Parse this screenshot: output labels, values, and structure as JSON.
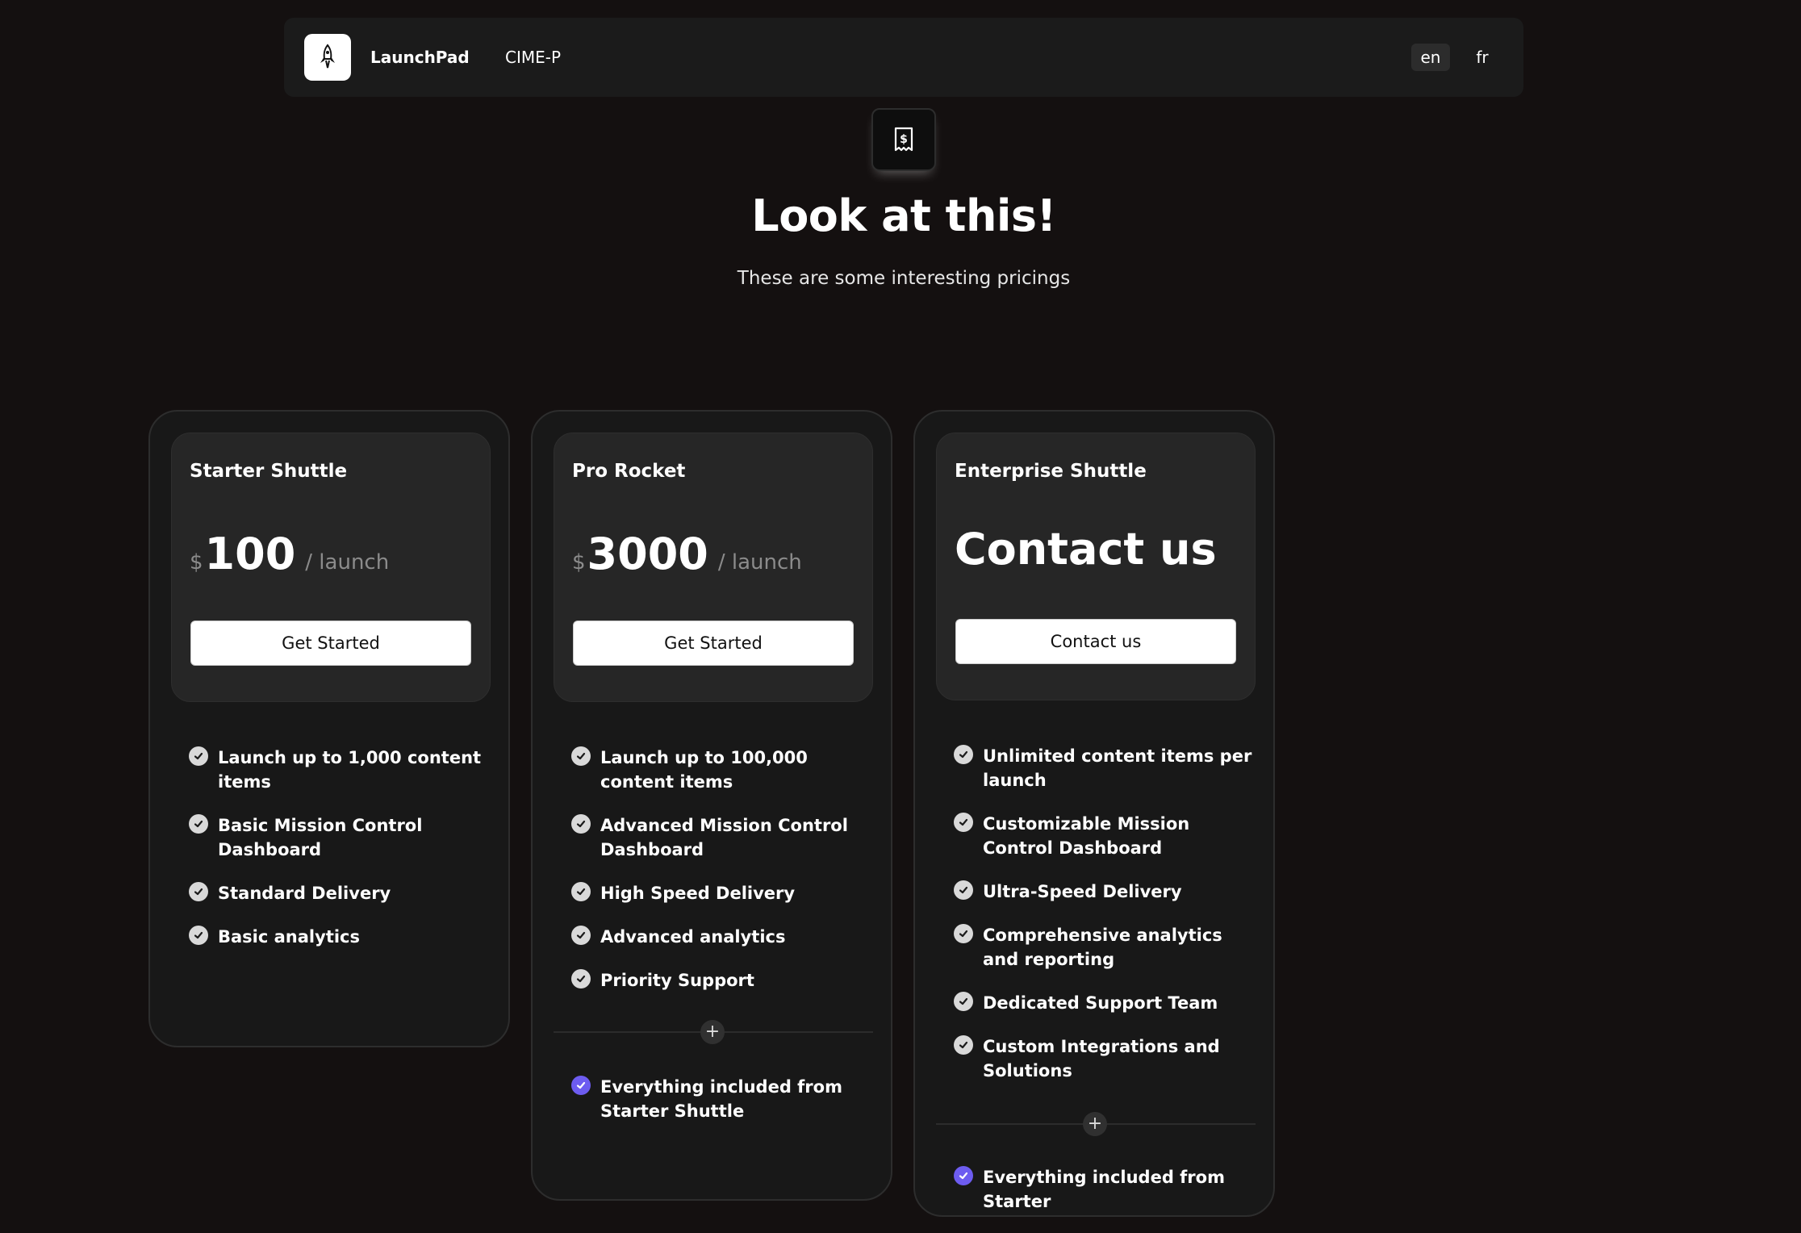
{
  "nav": {
    "brand": "LaunchPad",
    "link": "CIME-P",
    "languages": [
      "en",
      "fr"
    ],
    "active_language": "en",
    "logo_icon": "rocket-icon"
  },
  "hero": {
    "icon": "receipt-dollar-icon",
    "title": "Look at this!",
    "subtitle": "These are some interesting pricings"
  },
  "plans": [
    {
      "name": "Starter Shuttle",
      "currency": "$",
      "price": "100",
      "period": "/ launch",
      "cta": "Get Started",
      "features": [
        "Launch up to 1,000 content items",
        "Basic Mission Control Dashboard",
        "Standard Delivery",
        "Basic analytics"
      ]
    },
    {
      "name": "Pro Rocket",
      "currency": "$",
      "price": "3000",
      "period": "/ launch",
      "cta": "Get Started",
      "features": [
        "Launch up to 100,000 content items",
        "Advanced Mission Control Dashboard",
        "High Speed Delivery",
        "Advanced analytics",
        "Priority Support"
      ],
      "included": "Everything included from Starter Shuttle"
    },
    {
      "name": "Enterprise Shuttle",
      "price_text": "Contact us",
      "cta": "Contact us",
      "features": [
        "Unlimited content items per launch",
        "Customizable Mission Control Dashboard",
        "Ultra-Speed Delivery",
        "Comprehensive analytics and reporting",
        "Dedicated Support Team",
        "Custom Integrations and Solutions"
      ],
      "included": "Everything included from Starter"
    }
  ],
  "colors": {
    "background": "#141010",
    "card": "#181818",
    "card_top": "#262626",
    "accent_check": "#6d5cf0"
  }
}
